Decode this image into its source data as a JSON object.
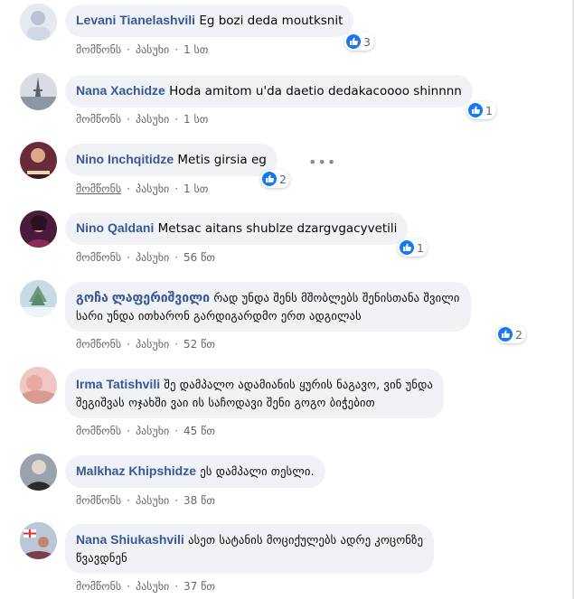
{
  "actions": {
    "like": "მომწონს",
    "reply": "პასუხი",
    "sep": "·"
  },
  "more_dots": "•••",
  "comments": [
    {
      "author": "Levani Tianelashvili",
      "text": "Eg bozi deda moutksnit",
      "likes": "3",
      "time": "1 სთ"
    },
    {
      "author": "Nana Xachidze",
      "text": "Hoda amitom u'da daetio dedakacoooo shinnnn",
      "likes": "1",
      "time": "1 სთ"
    },
    {
      "author": "Nino Inchqitidze",
      "text": "Metis girsia eg",
      "likes": "2",
      "time": "1 სთ"
    },
    {
      "author": "Nino Qaldani",
      "text": "Metsac aitans shublze dzargvgacyvetili",
      "likes": "1",
      "time": "56 წთ"
    },
    {
      "author": "გოჩა ლაფერიშვილი",
      "text_line1": "რად უნდა შენს მშობლებს შენისთანა შვილი",
      "text_line2": "სარი უნდა ითხარონ გარდიგარდმო ერთ ადგილას",
      "likes": "2",
      "time": "52 წთ"
    },
    {
      "author": "Irma Tatishvili",
      "text_line1": "შე დამპალო ადამიანის ყურის ნაგავო, ვინ უნდა",
      "text_line2": "შეგიშვას ოჯახში ვაი ის საჩოდავი შენი გოგო ბიჭებით",
      "time": "45 წთ"
    },
    {
      "author": "Malkhaz Khipshidze",
      "text": "ეს დამპალი თესლი.",
      "time": "38 წთ"
    },
    {
      "author": "Nana Shiukashvili",
      "text_line1": "ასეთ სატანის მოციქულებს ადრე კოცონზე",
      "text_line2": "წვავდნენ",
      "time": "37 წთ"
    }
  ],
  "colors": {
    "author": "#385898",
    "bubble": "#f0f2f5",
    "meta": "#65676b",
    "like_blue": "#1877f2"
  },
  "icons": {
    "like": "thumbs-up-icon",
    "more": "more-options-icon"
  }
}
